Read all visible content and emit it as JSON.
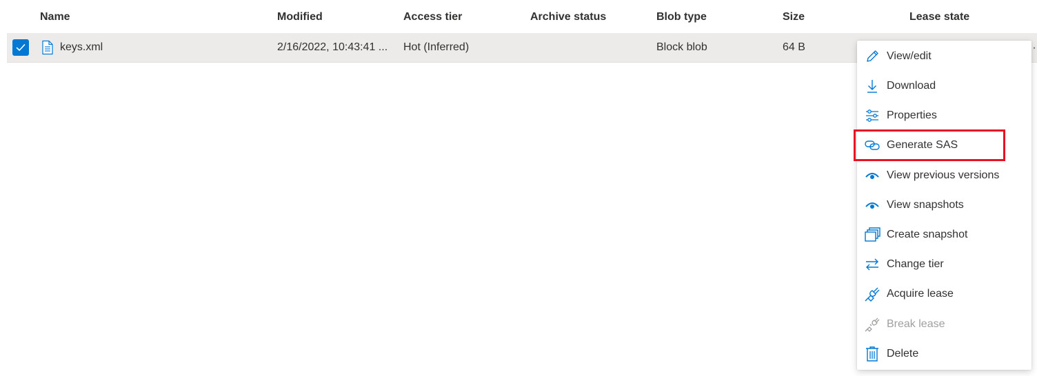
{
  "colors": {
    "accent": "#0078d4",
    "row_selected_bg": "#edebe9",
    "disabled_text": "#a19f9d",
    "highlight_border": "#e81123"
  },
  "table": {
    "columns": [
      "Name",
      "Modified",
      "Access tier",
      "Archive status",
      "Blob type",
      "Size",
      "Lease state"
    ],
    "rows": [
      {
        "selected": true,
        "name": "keys.xml",
        "modified": "2/16/2022, 10:43:41 ...",
        "access_tier": "Hot (Inferred)",
        "archive_status": "",
        "blob_type": "Block blob",
        "size": "64 B",
        "lease_state": ""
      }
    ]
  },
  "context_menu": {
    "items": [
      {
        "label": "View/edit",
        "icon": "pencil-icon",
        "disabled": false
      },
      {
        "label": "Download",
        "icon": "download-icon",
        "disabled": false
      },
      {
        "label": "Properties",
        "icon": "sliders-icon",
        "disabled": false
      },
      {
        "label": "Generate SAS",
        "icon": "link-icon",
        "disabled": false,
        "highlighted": true
      },
      {
        "label": "View previous versions",
        "icon": "eye-icon",
        "disabled": false
      },
      {
        "label": "View snapshots",
        "icon": "eye-icon",
        "disabled": false
      },
      {
        "label": "Create snapshot",
        "icon": "snapshot-icon",
        "disabled": false
      },
      {
        "label": "Change tier",
        "icon": "swap-icon",
        "disabled": false
      },
      {
        "label": "Acquire lease",
        "icon": "plug-icon",
        "disabled": false
      },
      {
        "label": "Break lease",
        "icon": "plug-broken-icon",
        "disabled": true
      },
      {
        "label": "Delete",
        "icon": "trash-icon",
        "disabled": false
      }
    ]
  }
}
